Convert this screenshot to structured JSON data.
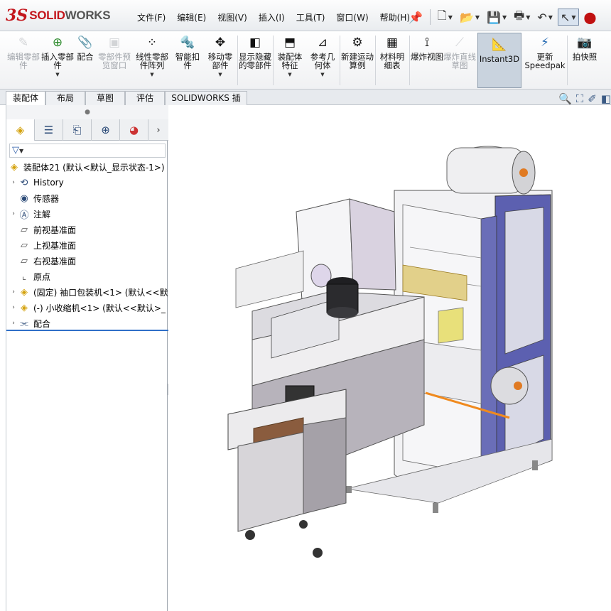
{
  "app": {
    "logo_ds": "3S",
    "logo_solid": "SOLID",
    "logo_works": "WORKS"
  },
  "menu": [
    "文件(F)",
    "编辑(E)",
    "视图(V)",
    "插入(I)",
    "工具(T)",
    "窗口(W)",
    "帮助(H)"
  ],
  "toolbar": [
    {
      "label": "编辑零部件",
      "icon": "edit-component-icon",
      "disabled": true
    },
    {
      "label": "插入零部件",
      "icon": "insert-component-icon",
      "disabled": false
    },
    {
      "label": "配合",
      "icon": "mate-icon",
      "disabled": false
    },
    {
      "label": "零部件预览窗口",
      "icon": "component-preview-icon",
      "disabled": true
    },
    {
      "label": "线性零部件阵列",
      "icon": "linear-pattern-icon",
      "disabled": false
    },
    {
      "label": "智能扣件",
      "icon": "smart-fastener-icon",
      "disabled": false
    },
    {
      "label": "移动零部件",
      "icon": "move-component-icon",
      "disabled": false
    },
    {
      "label": "显示隐藏的零部件",
      "icon": "show-hidden-icon",
      "disabled": false
    },
    {
      "label": "装配体特征",
      "icon": "assembly-feature-icon",
      "disabled": false
    },
    {
      "label": "参考几何体",
      "icon": "reference-geometry-icon",
      "disabled": false
    },
    {
      "label": "新建运动算例",
      "icon": "motion-study-icon",
      "disabled": false
    },
    {
      "label": "材料明细表",
      "icon": "bom-icon",
      "disabled": false
    },
    {
      "label": "爆炸视图",
      "icon": "exploded-view-icon",
      "disabled": false
    },
    {
      "label": "爆炸直线草图",
      "icon": "explode-line-icon",
      "disabled": true
    },
    {
      "label": "Instant3D",
      "icon": "instant3d-icon",
      "disabled": false
    },
    {
      "label": "更新Speedpak",
      "icon": "speedpak-icon",
      "disabled": false
    },
    {
      "label": "拍快照",
      "icon": "snapshot-icon",
      "disabled": false
    }
  ],
  "tabs": [
    "装配体",
    "布局",
    "草图",
    "评估",
    "SOLIDWORKS 插件"
  ],
  "tree": {
    "root": "装配体21  (默认<默认_显示状态-1>)",
    "items": [
      {
        "label": "History",
        "expandable": true,
        "icon": "history-icon"
      },
      {
        "label": "传感器",
        "expandable": false,
        "icon": "sensor-icon"
      },
      {
        "label": "注解",
        "expandable": true,
        "icon": "annotation-icon"
      },
      {
        "label": "前视基准面",
        "expandable": false,
        "icon": "plane-icon"
      },
      {
        "label": "上视基准面",
        "expandable": false,
        "icon": "plane-icon"
      },
      {
        "label": "右视基准面",
        "expandable": false,
        "icon": "plane-icon"
      },
      {
        "label": "原点",
        "expandable": false,
        "icon": "origin-icon"
      },
      {
        "label": "(固定) 袖口包装机<1> (默认<<默",
        "expandable": true,
        "icon": "part-icon"
      },
      {
        "label": "(-) 小收缩机<1> (默认<<默认>_",
        "expandable": true,
        "icon": "part-icon"
      },
      {
        "label": "配合",
        "expandable": true,
        "icon": "mates-folder-icon"
      }
    ]
  },
  "colors": {
    "accent": "#2f6fc8",
    "frame_purple": "#5a5fae",
    "stripe_orange": "#f08a1e"
  }
}
